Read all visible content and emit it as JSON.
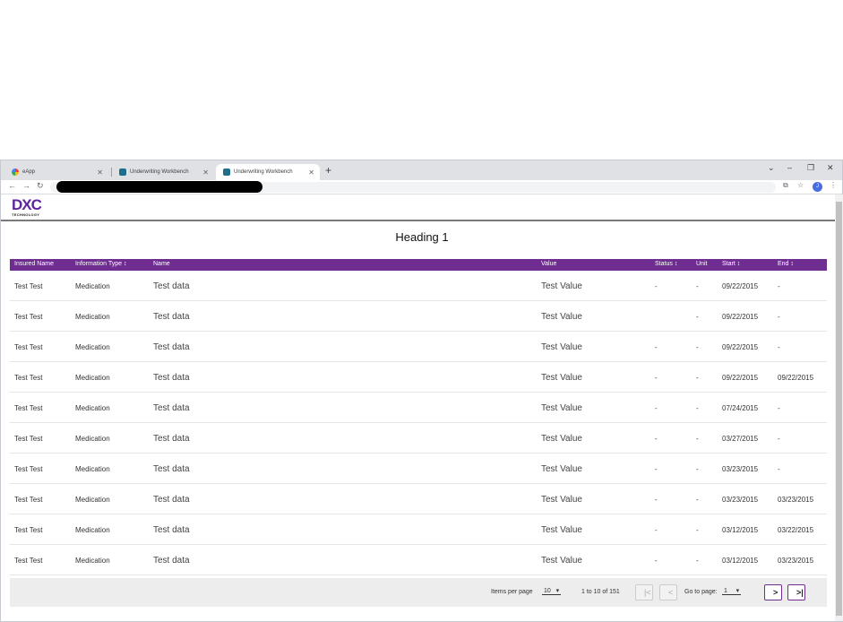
{
  "browser": {
    "tabs": [
      {
        "label": "eApp"
      },
      {
        "label": "Underwriting Workbench"
      },
      {
        "label": "Underwriting Workbench"
      }
    ],
    "new_tab": "+",
    "profile_initial": "J"
  },
  "app": {
    "logo_text": "DXC",
    "logo_sub": "TECHNOLOGY"
  },
  "main": {
    "heading": "Heading 1"
  },
  "table": {
    "columns": {
      "insured_name": "Insured Name",
      "info_type": "Information Type",
      "name": "Name",
      "value": "Value",
      "status": "Status",
      "unit": "Unit",
      "start": "Start",
      "end": "End"
    },
    "rows": [
      {
        "insured": "Test Test",
        "type": "Medication",
        "name": "Test data",
        "value": "Test Value",
        "status": "-",
        "unit": "-",
        "start": "09/22/2015",
        "end": "-"
      },
      {
        "insured": "Test Test",
        "type": "Medication",
        "name": "Test data",
        "value": "Test Value",
        "status": "",
        "unit": "-",
        "start": "09/22/2015",
        "end": "-"
      },
      {
        "insured": "Test Test",
        "type": "Medication",
        "name": "Test data",
        "value": "Test Value",
        "status": "-",
        "unit": "-",
        "start": "09/22/2015",
        "end": "-"
      },
      {
        "insured": "Test Test",
        "type": "Medication",
        "name": "Test data",
        "value": "Test Value",
        "status": "-",
        "unit": "-",
        "start": "09/22/2015",
        "end": "09/22/2015"
      },
      {
        "insured": "Test Test",
        "type": "Medication",
        "name": "Test data",
        "value": "Test Value",
        "status": "-",
        "unit": "-",
        "start": "07/24/2015",
        "end": "-"
      },
      {
        "insured": "Test Test",
        "type": "Medication",
        "name": "Test data",
        "value": "Test Value",
        "status": "-",
        "unit": "-",
        "start": "03/27/2015",
        "end": "-"
      },
      {
        "insured": "Test Test",
        "type": "Medication",
        "name": "Test data",
        "value": "Test Value",
        "status": "-",
        "unit": "-",
        "start": "03/23/2015",
        "end": "-"
      },
      {
        "insured": "Test Test",
        "type": "Medication",
        "name": "Test data",
        "value": "Test Value",
        "status": "-",
        "unit": "-",
        "start": "03/23/2015",
        "end": "03/23/2015"
      },
      {
        "insured": "Test Test",
        "type": "Medication",
        "name": "Test data",
        "value": "Test Value",
        "status": "-",
        "unit": "-",
        "start": "03/12/2015",
        "end": "03/22/2015"
      },
      {
        "insured": "Test Test",
        "type": "Medication",
        "name": "Test data",
        "value": "Test Value",
        "status": "-",
        "unit": "-",
        "start": "03/12/2015",
        "end": "03/23/2015"
      }
    ]
  },
  "pager": {
    "items_per_page_label": "Items per page",
    "items_per_page_value": "10",
    "range_text": "1 to 10 of 151",
    "go_to_label": "Go to page:",
    "go_to_value": "1",
    "first_icon": "|<",
    "prev_icon": "<",
    "next_icon": ">",
    "last_icon": ">|"
  },
  "colors": {
    "accent": "#6f2c91"
  }
}
